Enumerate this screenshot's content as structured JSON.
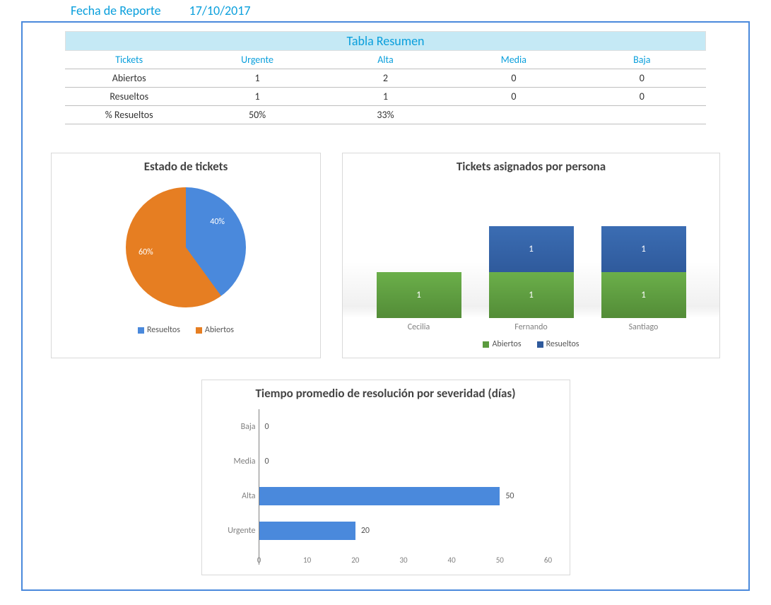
{
  "header": {
    "label": "Fecha de Reporte",
    "date": "17/10/2017"
  },
  "summary": {
    "title": "Tabla Resumen",
    "columns": [
      "Tickets",
      "Urgente",
      "Alta",
      "Media",
      "Baja"
    ],
    "rows": [
      {
        "label": "Abiertos",
        "urgente": "1",
        "alta": "2",
        "media": "0",
        "baja": "0"
      },
      {
        "label": "Resueltos",
        "urgente": "1",
        "alta": "1",
        "media": "0",
        "baja": "0"
      },
      {
        "label": "% Resueltos",
        "urgente": "50%",
        "alta": "33%",
        "media": "",
        "baja": ""
      }
    ]
  },
  "pie": {
    "title": "Estado de tickets",
    "legend": {
      "resueltos": "Resueltos",
      "abiertos": "Abiertos"
    },
    "labels": {
      "resueltos": "40%",
      "abiertos": "60%"
    }
  },
  "stacked": {
    "title": "Tickets asignados por persona",
    "legend": {
      "abiertos": "Abiertos",
      "resueltos": "Resueltos"
    },
    "cats": [
      "Cecilia",
      "Fernando",
      "Santiago"
    ],
    "labels": {
      "cecilia_abiertos": "1",
      "fernando_abiertos": "1",
      "fernando_resueltos": "1",
      "santiago_abiertos": "1",
      "santiago_resueltos": "1"
    }
  },
  "hbar": {
    "title": "Tiempo promedio de resolución por severidad (días)",
    "cats": [
      "Baja",
      "Media",
      "Alta",
      "Urgente"
    ],
    "values": {
      "baja": "0",
      "media": "0",
      "alta": "50",
      "urgente": "20"
    },
    "xticks": [
      "0",
      "10",
      "20",
      "30",
      "40",
      "50",
      "60"
    ]
  },
  "chart_data": [
    {
      "type": "pie",
      "title": "Estado de tickets",
      "series": [
        {
          "name": "Resueltos",
          "value": 40,
          "color": "#4A89DC"
        },
        {
          "name": "Abiertos",
          "value": 60,
          "color": "#E67E22"
        }
      ]
    },
    {
      "type": "bar",
      "subtype": "stacked",
      "title": "Tickets asignados por persona",
      "categories": [
        "Cecilia",
        "Fernando",
        "Santiago"
      ],
      "series": [
        {
          "name": "Abiertos",
          "values": [
            1,
            1,
            1
          ],
          "color": "#5B9B3E"
        },
        {
          "name": "Resueltos",
          "values": [
            0,
            1,
            1
          ],
          "color": "#2F5A9C"
        }
      ],
      "ylim": [
        0,
        2
      ]
    },
    {
      "type": "bar",
      "orientation": "horizontal",
      "title": "Tiempo promedio de resolución por severidad (días)",
      "categories": [
        "Baja",
        "Media",
        "Alta",
        "Urgente"
      ],
      "values": [
        0,
        0,
        50,
        20
      ],
      "xlim": [
        0,
        60
      ],
      "xticks": [
        0,
        10,
        20,
        30,
        40,
        50,
        60
      ],
      "color": "#4A89DC"
    }
  ]
}
